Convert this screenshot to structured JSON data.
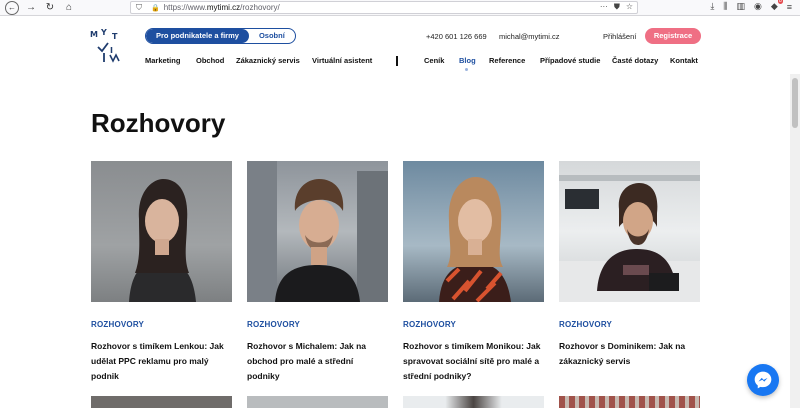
{
  "browser": {
    "url_prefix": "https://www.",
    "url_domain": "mytimi.cz",
    "url_path": "/rozhovory/",
    "notification_count": "8"
  },
  "header": {
    "logo_letters": [
      "M",
      "Y",
      "T",
      "I"
    ],
    "segment": {
      "active": "Pro podnikatele a firmy",
      "inactive": "Osobní"
    },
    "phone": "+420 601 126 669",
    "email": "michal@mytimi.cz",
    "login": "Přihlášení",
    "register": "Registrace",
    "nav": [
      "Marketing",
      "Obchod",
      "Zákaznický servis",
      "Virtuální asistent",
      "Ceník",
      "Blog",
      "Reference",
      "Případové studie",
      "Časté dotazy",
      "Kontakt"
    ],
    "active_nav": "Blog"
  },
  "page": {
    "title": "Rozhovory",
    "cards": [
      {
        "tag": "ROZHOVORY",
        "title": "Rozhovor s timíkem Lenkou: Jak udělat PPC reklamu pro malý podnik"
      },
      {
        "tag": "ROZHOVORY",
        "title": "Rozhovor s Michalem: Jak na obchod pro malé a střední podniky"
      },
      {
        "tag": "ROZHOVORY",
        "title": "Rozhovor s timíkem Monikou: Jak spravovat sociální sítě pro malé a střední podniky?"
      },
      {
        "tag": "ROZHOVORY",
        "title": "Rozhovor s Dominikem: Jak na zákaznický servis"
      }
    ]
  },
  "colors": {
    "brand_blue": "#1e4fa0",
    "register_pink": "#ef6f84",
    "messenger_blue": "#1877f2"
  }
}
